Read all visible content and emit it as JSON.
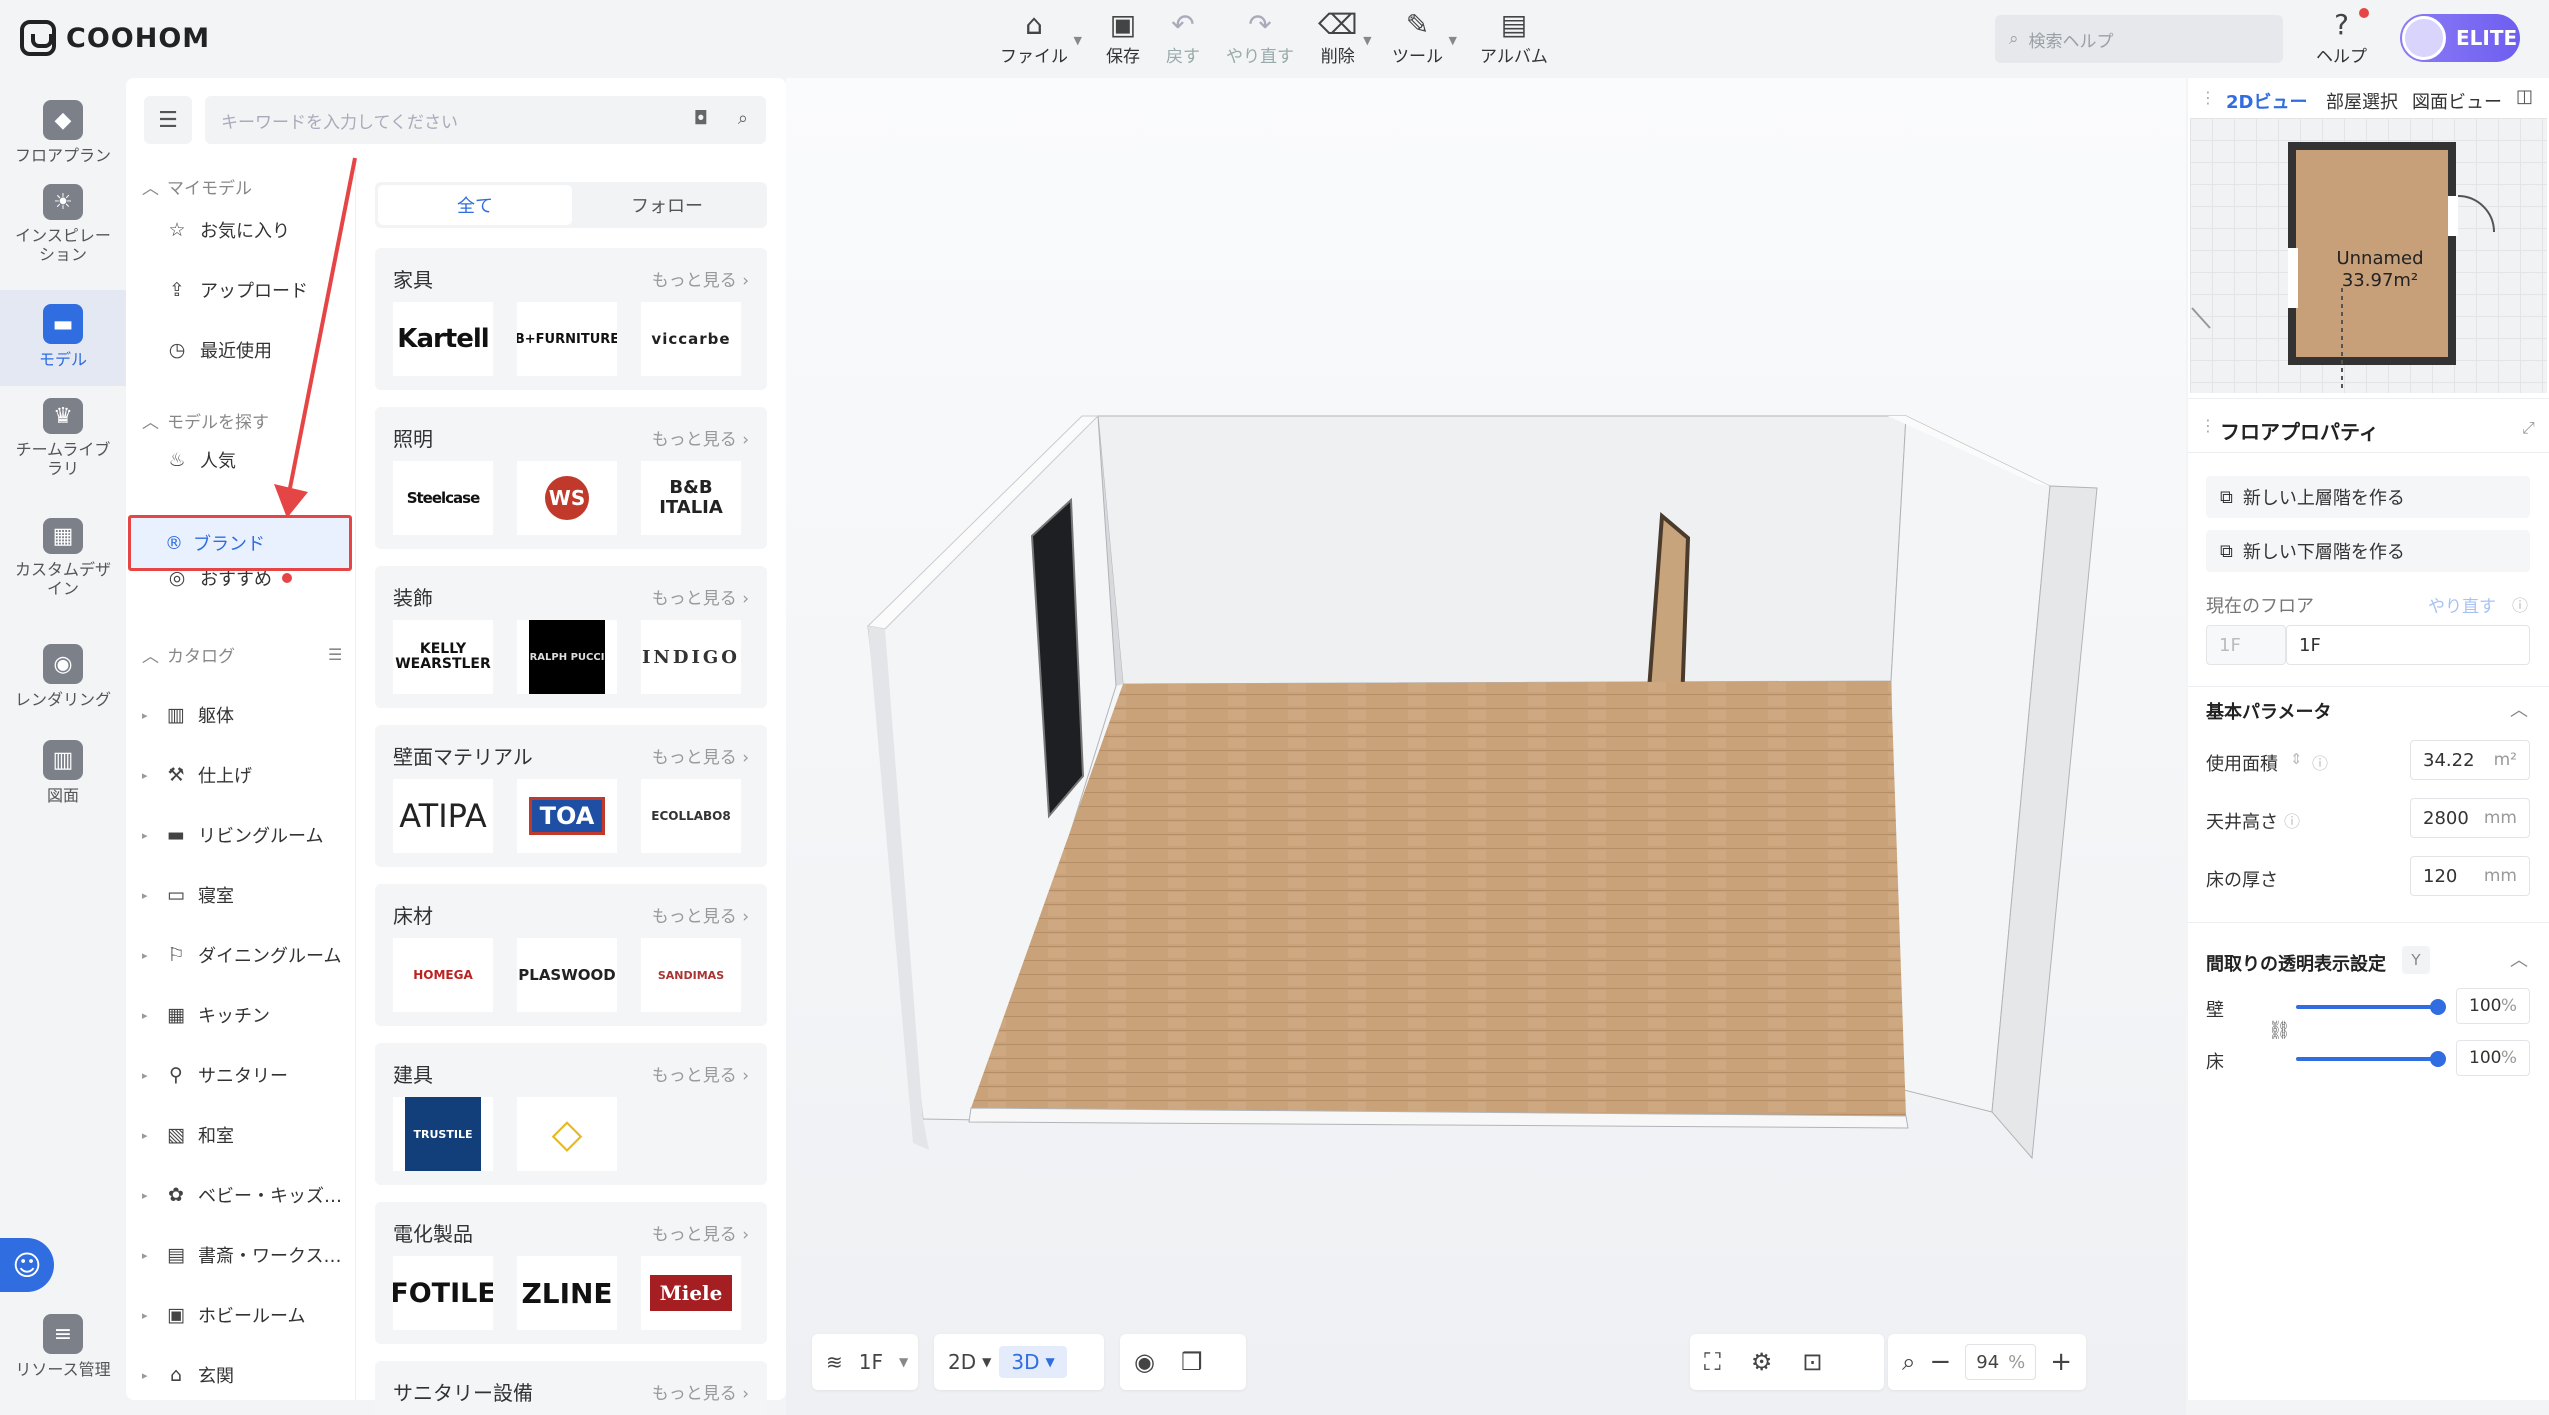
{
  "app": {
    "logo": "COOHOM"
  },
  "toolbar": {
    "items": [
      {
        "label": "ファイル",
        "icon": "file-icon",
        "enabled": true,
        "has_menu": true
      },
      {
        "label": "保存",
        "icon": "save-icon",
        "enabled": true,
        "has_menu": false
      },
      {
        "label": "戻す",
        "icon": "undo-icon",
        "enabled": false,
        "has_menu": false
      },
      {
        "label": "やり直す",
        "icon": "redo-icon",
        "enabled": false,
        "has_menu": false
      },
      {
        "label": "削除",
        "icon": "eraser-icon",
        "enabled": true,
        "has_menu": true
      },
      {
        "label": "ツール",
        "icon": "wrench-icon",
        "enabled": true,
        "has_menu": true
      },
      {
        "label": "アルバム",
        "icon": "album-icon",
        "enabled": true,
        "has_menu": false
      }
    ],
    "help_search_placeholder": "検索ヘルプ",
    "help_label": "ヘルプ",
    "plan_badge": "ELITE"
  },
  "rail": {
    "items": [
      {
        "label": "フロアプラン",
        "icon": "floorplan-icon"
      },
      {
        "label": "インスピレーション",
        "icon": "lightbulb-icon"
      },
      {
        "label": "モデル",
        "icon": "sofa-icon",
        "active": true
      },
      {
        "label": "チームライブラリ",
        "icon": "crown-icon"
      },
      {
        "label": "カスタムデザイン",
        "icon": "box-icon"
      },
      {
        "label": "レンダリング",
        "icon": "camera-icon"
      },
      {
        "label": "図面",
        "icon": "drawing-icon"
      }
    ],
    "bottom_label": "リソース管理"
  },
  "library": {
    "search_placeholder": "キーワードを入力してください",
    "my_models": {
      "title": "マイモデル",
      "items": [
        "お気に入り",
        "アップロード",
        "最近使用"
      ]
    },
    "find_models": {
      "title": "モデルを探す",
      "items": [
        "人気",
        "ブランド",
        "おすすめ"
      ]
    },
    "catalog": {
      "title": "カタログ",
      "items": [
        "躯体",
        "仕上げ",
        "リビングルーム",
        "寝室",
        "ダイニングルーム",
        "キッチン",
        "サニタリー",
        "和室",
        "ベビー・キッズ…",
        "書斎・ワークス…",
        "ホビールーム",
        "玄関"
      ]
    },
    "tabs": [
      "全て",
      "フォロー"
    ],
    "more_label": "もっと見る",
    "cards": [
      {
        "title": "家具",
        "logos": [
          "Kartell",
          "B+FURNITURE",
          "viccarbe"
        ]
      },
      {
        "title": "照明",
        "logos": [
          "Steelcase",
          "WS",
          "B&B ITALIA"
        ]
      },
      {
        "title": "装飾",
        "logos": [
          "KELLY WEARSTLER",
          "RALPH PUCCI",
          "INDIGO"
        ]
      },
      {
        "title": "壁面マテリアル",
        "logos": [
          "ATIPA",
          "TOA",
          "ECOLLABO8"
        ]
      },
      {
        "title": "床材",
        "logos": [
          "HOMEGA",
          "PLASWOOD",
          "SANDIMAS"
        ]
      },
      {
        "title": "建具",
        "logos": [
          "TRUSTILE",
          "◇"
        ]
      },
      {
        "title": "電化製品",
        "logos": [
          "FOTILE",
          "ZLINE",
          "Miele"
        ]
      },
      {
        "title": "サニタリー設備",
        "logos": []
      }
    ]
  },
  "canvas": {
    "floor_selector": "1F",
    "view_2d": "2D",
    "view_3d": "3D",
    "zoom": "94",
    "zoom_unit": "%"
  },
  "right_panel": {
    "tabs": [
      "2Dビュー",
      "部屋選択",
      "図面ビュー"
    ],
    "room_name": "Unnamed",
    "room_area": "33.97m²",
    "floor_props_title": "フロアプロパティ",
    "btn_new_upper": "新しい上層階を作る",
    "btn_new_lower": "新しい下層階を作る",
    "current_floor_label": "現在のフロア",
    "redo_label": "やり直す",
    "floor_prefix": "1F",
    "floor_value": "1F",
    "basic_params_title": "基本パラメータ",
    "params": [
      {
        "label": "使用面積",
        "value": "34.22",
        "unit": "m²"
      },
      {
        "label": "天井高さ",
        "value": "2800",
        "unit": "mm"
      },
      {
        "label": "床の厚さ",
        "value": "120",
        "unit": "mm"
      }
    ],
    "transparency_title": "間取りの透明表示設定",
    "transparency_badge": "Y",
    "transparency": [
      {
        "label": "壁",
        "value": "100",
        "unit": "%"
      },
      {
        "label": "床",
        "value": "100",
        "unit": "%"
      }
    ]
  },
  "colors": {
    "accent": "#2f6de0",
    "highlight_border": "#e64545"
  }
}
